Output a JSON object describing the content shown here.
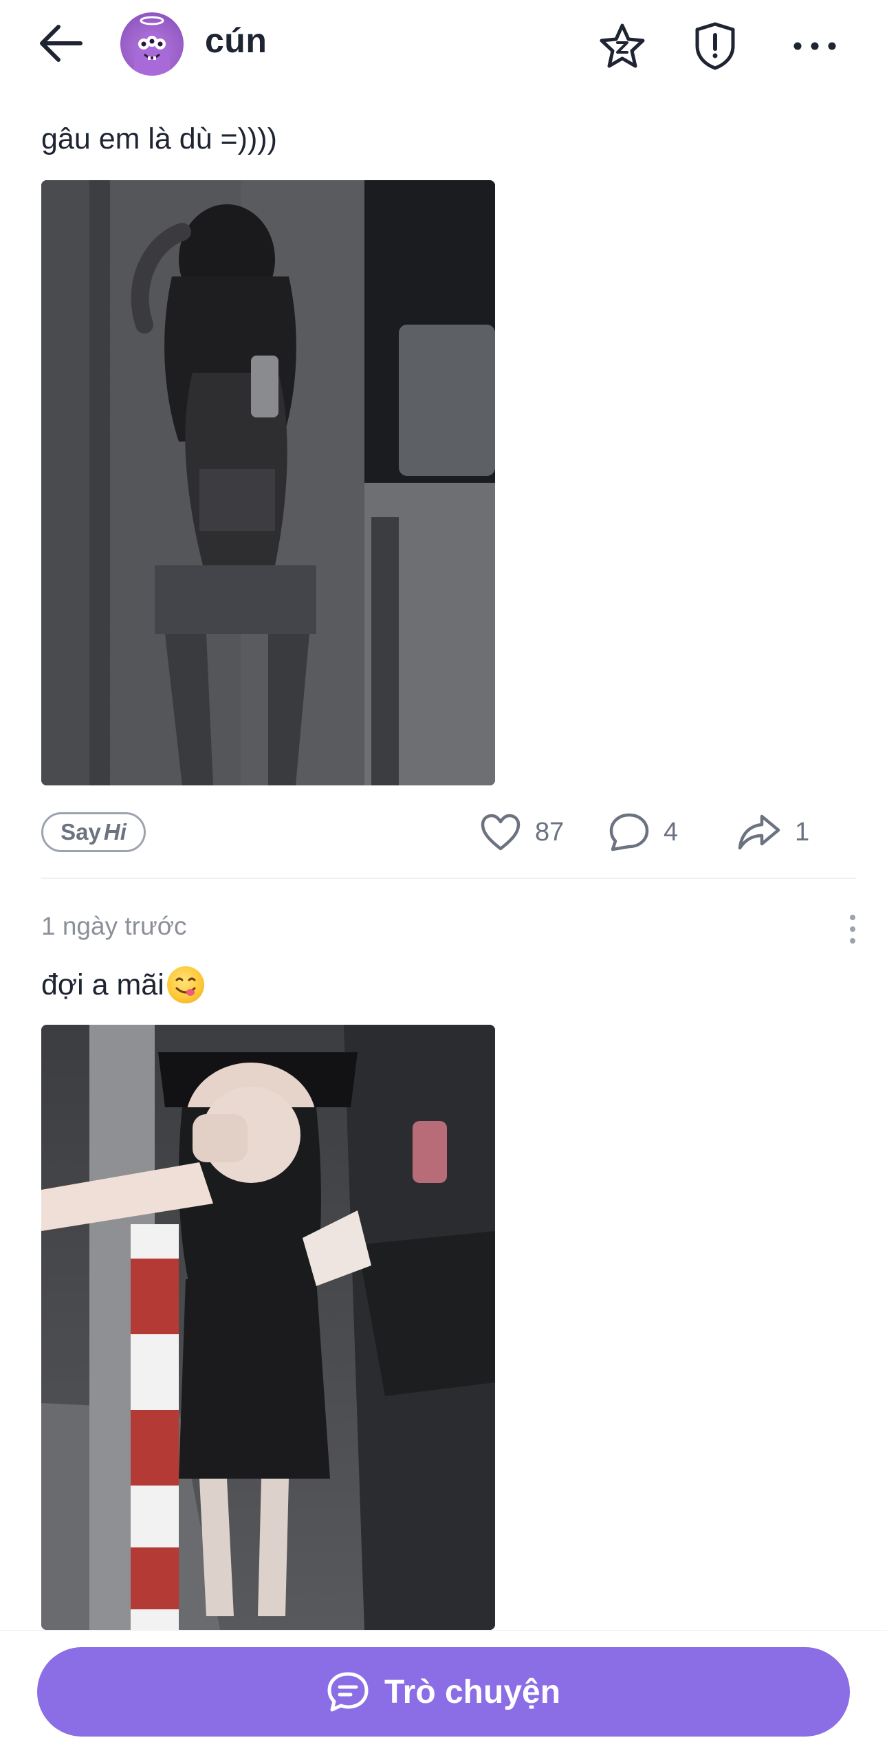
{
  "header": {
    "username": "cún",
    "icons": {
      "back": "arrow-left-icon",
      "star": "star-icon",
      "shield": "shield-alert-icon",
      "more": "more-horizontal-icon"
    }
  },
  "posts": [
    {
      "text": "gâu em là dù =))))",
      "image_alt": "mirror selfie photo",
      "actions": {
        "sayhi_say": "Say",
        "sayhi_hi": "Hi",
        "likes": "87",
        "comments": "4",
        "shares": "1"
      }
    },
    {
      "timestamp": "1 ngày trước",
      "text": "đợi a mãi",
      "emoji": "face-savoring-food-emoji",
      "image_alt": "street night photo"
    }
  ],
  "footer": {
    "chat_label": "Trò chuyện",
    "chat_icon": "chat-bubble-icon"
  },
  "colors": {
    "accent": "#8b6de6",
    "text": "#1f2433",
    "muted": "#6b7280"
  }
}
